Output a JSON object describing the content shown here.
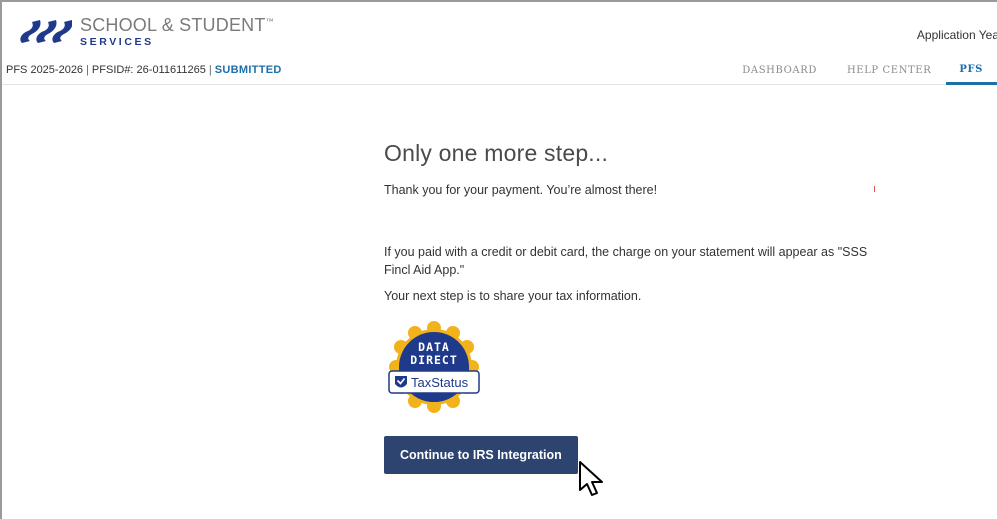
{
  "header": {
    "logo_line1": "SCHOOL & STUDENT",
    "logo_tm": "™",
    "logo_line2": "SERVICES",
    "application_year": "Application Yea"
  },
  "subheader": {
    "pfs_year": "PFS 2025-2026",
    "pfsid": "PFSID#: 26-011611265",
    "separator": "|",
    "status": "SUBMITTED",
    "nav": [
      "DASHBOARD",
      "HELP CENTER",
      "PFS"
    ]
  },
  "main": {
    "title": "Only one more step...",
    "thanks": "Thank you for your payment. You’re almost there!",
    "card_note": "If you paid with a credit or debit card, the charge on your statement will appear as \"SSS Fincl Aid App.\"",
    "next_step": "Your next step is to share your tax information.",
    "badge": {
      "line1": "DATA",
      "line2": "DIRECT",
      "brand": "TaxStatus",
      "icon": "taxstatus-shield-icon"
    },
    "button_label": "Continue to IRS Integration"
  },
  "colors": {
    "brand_blue": "#1e6fa8",
    "button_navy": "#2d4470",
    "badge_navy": "#1f3a8a",
    "badge_gold": "#f2b21c"
  }
}
